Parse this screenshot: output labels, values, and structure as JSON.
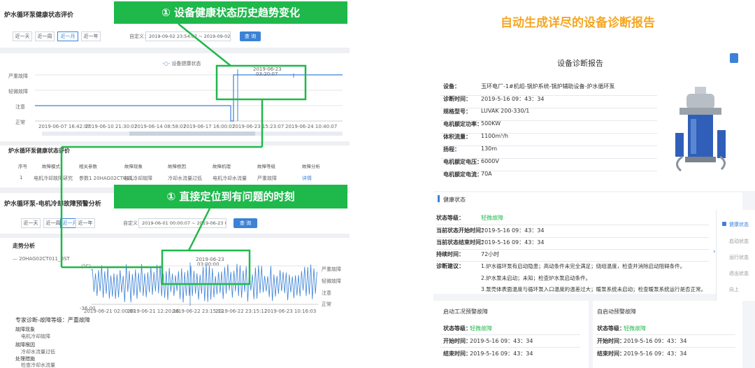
{
  "left": {
    "section1_title": "炉水循环泵健康状态评价",
    "range_buttons": [
      "近一天",
      "近一周",
      "近一月",
      "近一年"
    ],
    "custom_label": "自定义：",
    "custom_range_1": "2019-09-02 23:54:07 ~ 2019-09-02 23:54:07",
    "query_label_1": "查 询",
    "legend_label": "设备健康状态",
    "y_levels": [
      "严重故障",
      "轻微故障",
      "注意",
      "正常"
    ],
    "chart1_ticks": [
      "2019-06-07 16:42:07",
      "2019-06-10 21:30:07",
      "2019-06-14 08:58:07",
      "2019-06-17 16:00:07",
      "2019-06-23 15:23:07",
      "2019-06-24 10:40:07"
    ],
    "chart1_marker_date": "2019-06-23",
    "chart1_marker_time": "03:20:07",
    "table_title": "炉水循环泵健康状态评价",
    "table_headers": [
      "序号",
      "故障模式",
      "相关参数",
      "故障现象",
      "故障根因",
      "故障机理",
      "故障等级",
      "故障分析"
    ],
    "table_row": [
      "1",
      "电机冷却故障研究",
      "参数1 20HAG02CT011...",
      "电机冷却故障",
      "冷却水流量过低",
      "电机冷却水流量",
      "严重故障",
      "详情"
    ],
    "section2_title": "炉水循环泵-电机冷却故障预警分析",
    "range_buttons_2": [
      "近一天",
      "近一周",
      "近一月",
      "近一年"
    ],
    "custom_label_2": "自定义",
    "custom_range_2": "2019-06-01 00:00:07 ~ 2019-06-23 00:00:07",
    "query_label_2": "查 询",
    "trend_title": "走势分析",
    "series_label": "20HAG02CT011_BST",
    "chart2_marker_date": "2019-06-23",
    "chart2_marker_time": "03:00:00",
    "chart2_ticks": [
      "2019-06-21 02:00:07",
      "2019-06-21 12:20:16",
      "2019-06-22 23:15:12",
      "2019-06-22 23:15:12",
      "2019-06-23 10:16:03"
    ],
    "chart2_right_levels": [
      "严重故障",
      "轻微故障",
      "注意",
      "正常"
    ],
    "chart2_y_top": "(°C)",
    "chart2_y_bottom": "-36.00",
    "bottom_title": "专家诊断-故障等级：严重故障",
    "bottom_items": [
      "故障现象",
      "电机冷却故障",
      "故障根因",
      "冷却水流量过低",
      "处理措施",
      "检查冷却水流量"
    ]
  },
  "banners": {
    "banner1": "① 设备健康状态历史趋势变化",
    "banner2": "① 直接定位到有问题的时刻",
    "right_headline": "自动生成详尽的设备诊断报告"
  },
  "report": {
    "title": "设备诊断报告",
    "info": [
      {
        "label": "设备：",
        "value": "玉环电厂-1#机组-锅炉系统-锅炉辅助设备-炉水循环泵"
      },
      {
        "label": "诊断时间：",
        "value": "2019-5-16  09：43：34"
      },
      {
        "label": "规格型号：",
        "value": "LUVAK  200-330/1"
      },
      {
        "label": "电机额定功率：",
        "value": "500KW"
      },
      {
        "label": "体积流量：",
        "value": "1100m³/h"
      },
      {
        "label": "扬程：",
        "value": "130m"
      },
      {
        "label": "电机额定电压：",
        "value": "6000V"
      },
      {
        "label": "电机额定电流：",
        "value": "70A"
      }
    ],
    "health_title": "健康状态",
    "health_rows": [
      {
        "label": "状态等级：",
        "value": "轻微故障",
        "green": true
      },
      {
        "label": "当前状态开始时间：",
        "value": "2019-5-16  09：43：34"
      },
      {
        "label": "当前状态结束时间：",
        "value": "2019-5-16  09：43：34"
      },
      {
        "label": "持续时间：",
        "value": "72小时"
      },
      {
        "label": "诊断建议：",
        "value": "1.炉水循环泵有启动隐患；高动条件未完全满足；绕组温度，检查并消除启动阻碍条件。"
      }
    ],
    "suggestions": [
      "2.炉水泵未启动；未知；检查炉水泵启动条件。",
      "3.泵壳体表面温度与循环泵入口温度的温差过大；暖泵系统未启动；检查暖泵系统运行是否正常。"
    ],
    "warn_cards": [
      {
        "title": "启动工况预警故障",
        "rows": [
          {
            "label": "状态等级：",
            "value": "轻微故障"
          },
          {
            "label": "开始时间：",
            "value": "2019-5-16  09：43：34"
          },
          {
            "label": "结束时间：",
            "value": "2019-5-16  09：43：34"
          }
        ]
      },
      {
        "title": "自启动预警故障",
        "rows": [
          {
            "label": "状态等级：",
            "value": "轻微故障"
          },
          {
            "label": "开始时间：",
            "value": "2019-5-16  09：43：34"
          },
          {
            "label": "结束时间：",
            "value": "2019-5-16  09：43：34"
          }
        ]
      }
    ],
    "side_nav": [
      "健康状态",
      "启动状态",
      "运行状态",
      "退出状态",
      "向上"
    ]
  },
  "colors": {
    "accent": "#3b82d6",
    "green": "#1fb84b",
    "orange": "#f5a623"
  }
}
